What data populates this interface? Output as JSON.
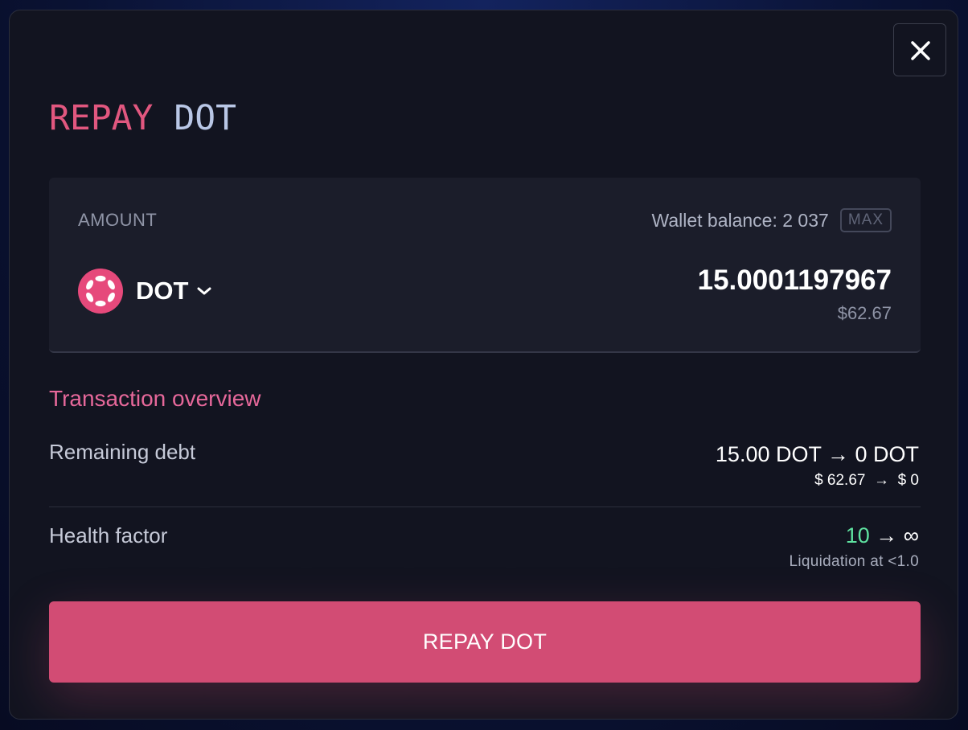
{
  "modal": {
    "title_word1": "REPAY",
    "title_word2": "DOT",
    "close_icon": "close-icon",
    "colors": {
      "title_primary": "#e1577f",
      "title_secondary": "#b9c7e6",
      "accent": "#d24c74",
      "positive": "#5fe3a1",
      "background": "#121420",
      "panel": "#1b1d2a"
    }
  },
  "amount": {
    "label": "AMOUNT",
    "wallet_balance": "Wallet balance: 2 037",
    "max_label": "MAX",
    "asset_symbol": "DOT",
    "asset_icon": "polkadot-icon",
    "value": "15.0001197967",
    "usd_value": "$62.67"
  },
  "overview": {
    "title": "Transaction overview",
    "remaining_debt": {
      "label": "Remaining debt",
      "main": "15.00 DOT → 0 DOT",
      "usd": "$ 62.67  →  $ 0"
    },
    "health_factor": {
      "label": "Health factor",
      "from": "10",
      "to": " → ∞",
      "note": "Liquidation at <1.0"
    }
  },
  "action": {
    "button_label": "REPAY DOT"
  }
}
